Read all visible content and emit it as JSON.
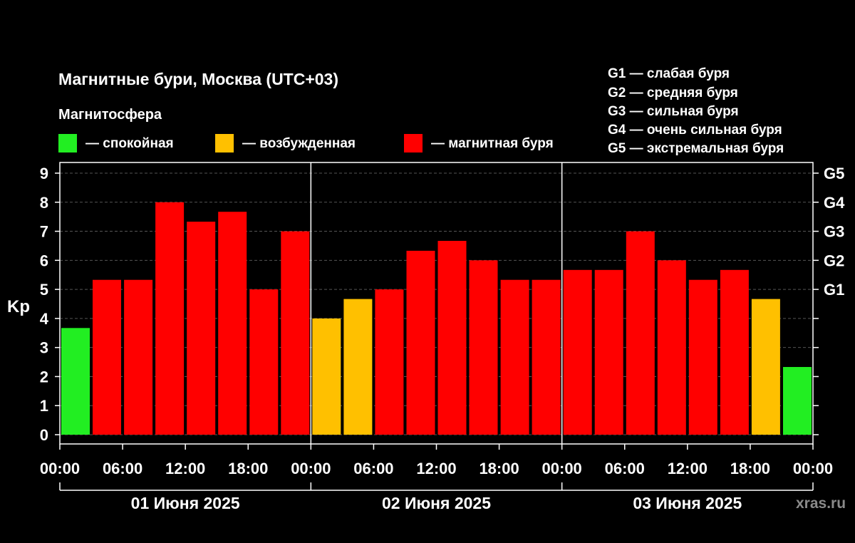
{
  "title": "Магнитные бури, Москва (UTC+03)",
  "subtitle": "Магнитосфера",
  "legend": [
    {
      "label": "— спокойная",
      "color": "#22ee22"
    },
    {
      "label": "— возбужденная",
      "color": "#ffc000"
    },
    {
      "label": "— магнитная буря",
      "color": "#ff0000"
    }
  ],
  "g_scale": [
    "G1 — слабая буря",
    "G2 — средняя буря",
    "G3 — сильная буря",
    "G4 — очень сильная буря",
    "G5 — экстремальная буря"
  ],
  "watermark": "xras.ru",
  "colors": {
    "quiet": "#22ee22",
    "active": "#ffc000",
    "storm": "#ff0000",
    "background": "#000000",
    "axis": "#ffffff"
  },
  "chart_data": {
    "type": "bar",
    "ylabel": "Kp",
    "xlabel": "",
    "ylim": [
      0,
      9
    ],
    "yticks": [
      "0",
      "1",
      "2",
      "3",
      "4",
      "5",
      "6",
      "7",
      "8",
      "9"
    ],
    "right_axis": [
      {
        "level": 5,
        "label": "G1"
      },
      {
        "level": 6,
        "label": "G2"
      },
      {
        "level": 7,
        "label": "G3"
      },
      {
        "level": 8,
        "label": "G4"
      },
      {
        "level": 9,
        "label": "G5"
      }
    ],
    "grid": "horizontal dashed",
    "x_tick_labels": [
      "00:00",
      "06:00",
      "12:00",
      "18:00",
      "00:00",
      "06:00",
      "12:00",
      "18:00",
      "00:00",
      "06:00",
      "12:00",
      "18:00",
      "00:00"
    ],
    "days": [
      "01 Июня 2025",
      "02 Июня 2025",
      "03 Июня 2025"
    ],
    "interval_hours": 3,
    "categories": [
      "00:00",
      "03:00",
      "06:00",
      "09:00",
      "12:00",
      "15:00",
      "18:00",
      "21:00"
    ],
    "series": [
      {
        "day": "01 Июня 2025",
        "values": [
          3.67,
          5.33,
          5.33,
          8.0,
          7.33,
          7.67,
          5.0,
          7.0
        ],
        "status": [
          "quiet",
          "storm",
          "storm",
          "storm",
          "storm",
          "storm",
          "storm",
          "storm"
        ]
      },
      {
        "day": "02 Июня 2025",
        "values": [
          4.0,
          4.67,
          5.0,
          6.33,
          6.67,
          6.0,
          5.33,
          5.33
        ],
        "status": [
          "active",
          "active",
          "storm",
          "storm",
          "storm",
          "storm",
          "storm",
          "storm"
        ]
      },
      {
        "day": "03 Июня 2025",
        "values": [
          5.67,
          5.67,
          7.0,
          6.0,
          5.33,
          5.67,
          4.67,
          2.33
        ],
        "status": [
          "storm",
          "storm",
          "storm",
          "storm",
          "storm",
          "storm",
          "active",
          "quiet"
        ]
      }
    ]
  }
}
